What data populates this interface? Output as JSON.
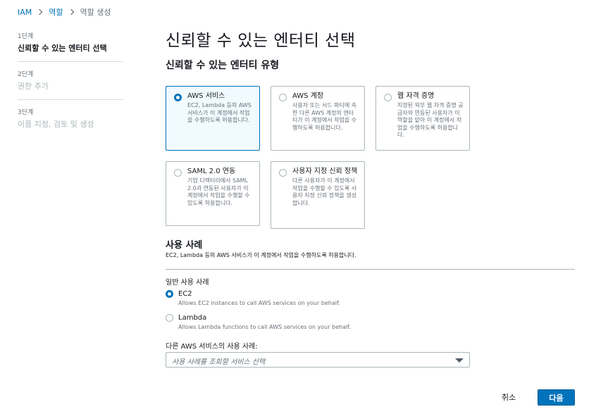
{
  "breadcrumb": {
    "items": [
      "IAM",
      "역할",
      "역할 생성"
    ]
  },
  "steps": [
    {
      "num": "1단계",
      "title": "신뢰할 수 있는 엔터티 선택"
    },
    {
      "num": "2단계",
      "title": "권한 추가"
    },
    {
      "num": "3단계",
      "title": "이름 지정, 검토 및 생성"
    }
  ],
  "page": {
    "title": "신뢰할 수 있는 엔터티 선택"
  },
  "entity_type": {
    "heading": "신뢰할 수 있는 엔터티 유형",
    "selected": "AWS 서비스",
    "tiles": [
      {
        "title": "AWS 서비스",
        "desc": "EC2, Lambda 등의 AWS 서비스가 이 계정에서 작업을 수행하도록 허용합니다."
      },
      {
        "title": "AWS 계정",
        "desc": "사용자 또는 서드 파티에 속한 다른 AWS 계정의 엔터티가 이 계정에서 작업을 수행하도록 허용합니다."
      },
      {
        "title": "웹 자격 증명",
        "desc": "지정된 외부 웹 자격 증명 공급자와 연동된 사용자가 이 역할을 맡아 이 계정에서 작업을 수행하도록 허용합니다."
      },
      {
        "title": "SAML 2.0 연동",
        "desc": "기업 디렉터리에서 SAML 2.0과 연동된 사용자가 이 계정에서 작업을 수행할 수 있도록 허용합니다."
      },
      {
        "title": "사용자 지정 신뢰 정책",
        "desc": "다른 사용자가 이 계정에서 작업을 수행할 수 있도록 사용자 지정 신뢰 정책을 생성합니다."
      }
    ]
  },
  "use_case": {
    "heading": "사용 사례",
    "desc": "EC2, Lambda 등의 AWS 서비스가 이 계정에서 작업을 수행하도록 허용합니다.",
    "group_label": "일반 사용 사례",
    "selected": "EC2",
    "options": [
      {
        "label": "EC2",
        "desc": "Allows EC2 instances to call AWS services on your behalf."
      },
      {
        "label": "Lambda",
        "desc": "Allows Lambda functions to call AWS services on your behalf."
      }
    ],
    "other_label": "다른 AWS 서비스의 사용 사례:",
    "other_placeholder": "사용 사례를 조회할 서비스 선택"
  },
  "footer": {
    "cancel": "취소",
    "next": "다음"
  },
  "colors": {
    "accent": "#0073bb",
    "selected_bg": "#f1faff",
    "border": "#aab7b8"
  }
}
